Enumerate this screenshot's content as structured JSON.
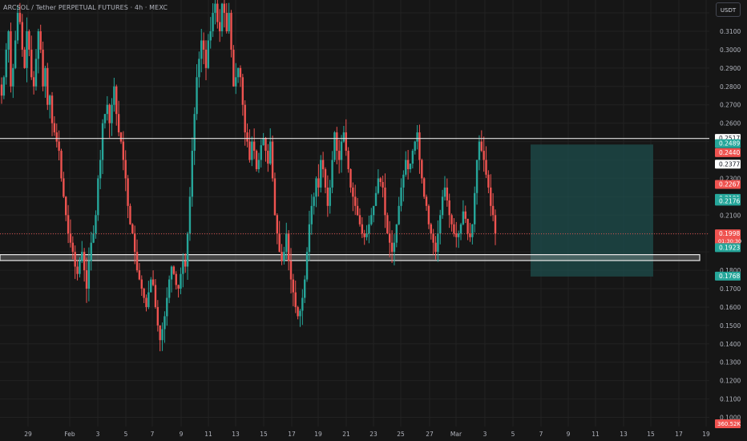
{
  "header": {
    "title": "ARCSOL / Tether PERPETUAL FUTURES · 4h · MEXC",
    "currency_button": "USDT"
  },
  "colors": {
    "background": "#161616",
    "grid": "#222222",
    "up": "#26a69a",
    "down": "#ef5350",
    "target_box": "#1e4e4c",
    "axis_text": "#b2b5be"
  },
  "chart_data": {
    "type": "candlestick",
    "ylim": [
      0.095,
      0.327
    ],
    "y_ticks": [
      0.32,
      0.31,
      0.3,
      0.29,
      0.28,
      0.27,
      0.26,
      0.23,
      0.21,
      0.18,
      0.17,
      0.16,
      0.15,
      0.14,
      0.13,
      0.12,
      0.11,
      0.1
    ],
    "x_ticks": [
      "29",
      "Feb",
      "3",
      "5",
      "7",
      "9",
      "11",
      "13",
      "15",
      "17",
      "19",
      "21",
      "23",
      "25",
      "27",
      "Mar",
      "3",
      "5",
      "7",
      "9",
      "11",
      "13",
      "15",
      "17",
      "19"
    ],
    "horizontal_line": 0.2517,
    "zone": [
      0.1885,
      0.1853
    ],
    "current_price_line": 0.1998,
    "target_box": {
      "top": 0.2484,
      "bottom": 0.1766
    },
    "price_labels": [
      {
        "text": "0.2517",
        "value": 0.2517,
        "style": "white"
      },
      {
        "text": "0.2489",
        "value": 0.2489,
        "style": "up"
      },
      {
        "text": "0.2440",
        "value": 0.244,
        "style": "down"
      },
      {
        "text": "0.2377",
        "value": 0.2377,
        "style": "white"
      },
      {
        "text": "0.2267",
        "value": 0.2267,
        "style": "down"
      },
      {
        "text": "0.2191",
        "value": 0.2191,
        "style": "up"
      },
      {
        "text": "0.2176",
        "value": 0.2176,
        "style": "up"
      },
      {
        "text": "0.1998",
        "value": 0.1998,
        "style": "down"
      },
      {
        "text": "0.1923",
        "value": 0.1923,
        "style": "up"
      },
      {
        "text": "0.1768",
        "value": 0.1768,
        "style": "up"
      }
    ],
    "countdown": "01:30:30",
    "volume_label": "360.52K",
    "closes": [
      0.275,
      0.285,
      0.3,
      0.31,
      0.28,
      0.29,
      0.305,
      0.32,
      0.315,
      0.3,
      0.29,
      0.31,
      0.3,
      0.285,
      0.28,
      0.295,
      0.31,
      0.3,
      0.28,
      0.29,
      0.27,
      0.275,
      0.26,
      0.255,
      0.25,
      0.245,
      0.23,
      0.22,
      0.21,
      0.2,
      0.195,
      0.19,
      0.182,
      0.178,
      0.185,
      0.19,
      0.18,
      0.17,
      0.185,
      0.195,
      0.2,
      0.21,
      0.23,
      0.24,
      0.26,
      0.265,
      0.27,
      0.26,
      0.27,
      0.28,
      0.265,
      0.255,
      0.25,
      0.24,
      0.23,
      0.215,
      0.205,
      0.2,
      0.19,
      0.18,
      0.175,
      0.17,
      0.165,
      0.16,
      0.168,
      0.175,
      0.172,
      0.16,
      0.15,
      0.142,
      0.148,
      0.155,
      0.165,
      0.175,
      0.182,
      0.178,
      0.172,
      0.17,
      0.178,
      0.185,
      0.182,
      0.2,
      0.22,
      0.245,
      0.265,
      0.285,
      0.295,
      0.305,
      0.3,
      0.29,
      0.305,
      0.31,
      0.32,
      0.325,
      0.315,
      0.31,
      0.325,
      0.32,
      0.31,
      0.32,
      0.3,
      0.28,
      0.285,
      0.29,
      0.285,
      0.27,
      0.255,
      0.25,
      0.24,
      0.25,
      0.245,
      0.235,
      0.24,
      0.248,
      0.252,
      0.245,
      0.238,
      0.25,
      0.23,
      0.21,
      0.2,
      0.19,
      0.185,
      0.19,
      0.2,
      0.185,
      0.175,
      0.168,
      0.16,
      0.155,
      0.158,
      0.165,
      0.175,
      0.19,
      0.205,
      0.215,
      0.22,
      0.23,
      0.225,
      0.24,
      0.235,
      0.225,
      0.215,
      0.225,
      0.24,
      0.255,
      0.245,
      0.24,
      0.25,
      0.255,
      0.245,
      0.235,
      0.225,
      0.22,
      0.215,
      0.21,
      0.205,
      0.2,
      0.198,
      0.2,
      0.205,
      0.21,
      0.215,
      0.222,
      0.23,
      0.228,
      0.225,
      0.21,
      0.2,
      0.195,
      0.19,
      0.195,
      0.205,
      0.215,
      0.225,
      0.232,
      0.24,
      0.235,
      0.238,
      0.245,
      0.25,
      0.255,
      0.24,
      0.23,
      0.22,
      0.215,
      0.205,
      0.2,
      0.195,
      0.19,
      0.2,
      0.21,
      0.22,
      0.225,
      0.218,
      0.21,
      0.205,
      0.2,
      0.198,
      0.2,
      0.205,
      0.212,
      0.208,
      0.2,
      0.198,
      0.205,
      0.222,
      0.24,
      0.25,
      0.245,
      0.24,
      0.232,
      0.225,
      0.215,
      0.21,
      0.2
    ]
  }
}
